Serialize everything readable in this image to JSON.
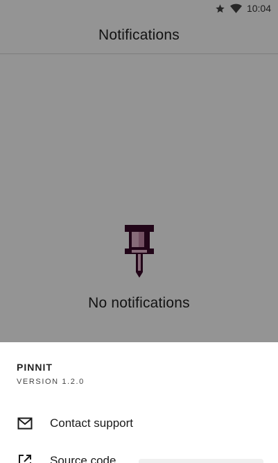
{
  "status_bar": {
    "time": "10:04",
    "icons": [
      "star-icon",
      "wifi-icon"
    ]
  },
  "toolbar": {
    "title": "Notifications"
  },
  "empty_state": {
    "icon": "pin-icon",
    "text": "No notifications"
  },
  "sheet": {
    "app_name": "PINNIT",
    "version": "VERSION 1.2.0",
    "items": [
      {
        "label": "Contact support",
        "icon": "mail-icon"
      },
      {
        "label": "Source code",
        "icon": "open-external-icon"
      }
    ]
  },
  "colors": {
    "pin_dark": "#3a0a2a",
    "pin_light": "#e8b8d0",
    "scrim": "#6b6b6b"
  }
}
